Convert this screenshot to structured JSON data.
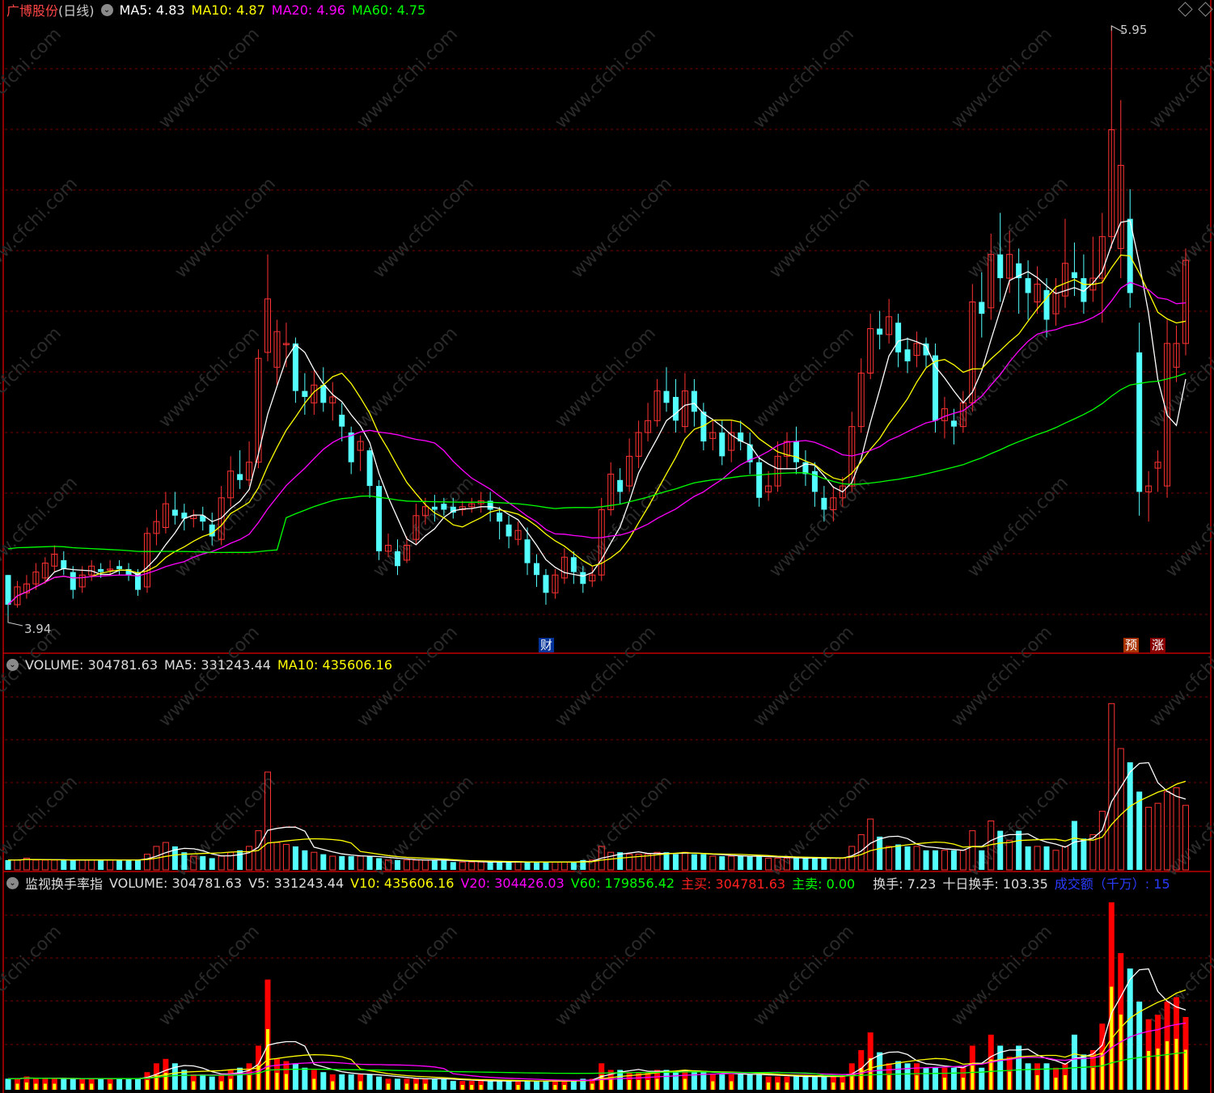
{
  "header": {
    "stock_name": "广博股份",
    "period": "(日线)",
    "ma5": "MA5: 4.83",
    "ma10": "MA10: 4.87",
    "ma20": "MA20: 4.96",
    "ma60": "MA60: 4.75"
  },
  "price_labels": {
    "high": "5.95",
    "low": "3.94"
  },
  "markers": {
    "cai": "财",
    "yu": "预",
    "zhang": "涨"
  },
  "volume_header": {
    "volume": "VOLUME: 304781.63",
    "ma5": "MA5: 331243.44",
    "ma10": "MA10: 435606.16"
  },
  "turnover_header": {
    "title": "监视换手率指",
    "volume": "VOLUME: 304781.63",
    "v5": "V5: 331243.44",
    "v10": "V10: 435606.16",
    "v20": "V20: 304426.03",
    "v60": "V60: 179856.42",
    "buy": "主买: 304781.63",
    "sell": "主卖: 0.00",
    "turnover": "换手: 7.23",
    "ten_day": "十日换手: 103.35",
    "amount": "成交额（千万）: 15"
  },
  "colors": {
    "up": "#ff3232",
    "down": "#54ffff",
    "ma5": "#ffffff",
    "ma10": "#ffff00",
    "ma20": "#ff00ff",
    "ma60": "#00ff00",
    "grid": "#7a0000",
    "separator": "#c00000"
  },
  "chart_data": {
    "type": "candlestick",
    "title": "广博股份 (日线)",
    "price_high": 5.95,
    "price_low": 3.94,
    "candles": [
      [
        4.1,
        4.0,
        4.1,
        3.94
      ],
      [
        4.0,
        4.06,
        4.08,
        3.99
      ],
      [
        4.04,
        4.07,
        4.1,
        4.02
      ],
      [
        4.07,
        4.11,
        4.14,
        4.05
      ],
      [
        4.09,
        4.14,
        4.16,
        4.07
      ],
      [
        4.13,
        4.17,
        4.2,
        4.11
      ],
      [
        4.15,
        4.12,
        4.18,
        4.1
      ],
      [
        4.11,
        4.05,
        4.13,
        4.02
      ],
      [
        4.06,
        4.1,
        4.13,
        4.04
      ],
      [
        4.1,
        4.13,
        4.15,
        4.08
      ],
      [
        4.12,
        4.11,
        4.14,
        4.09
      ],
      [
        4.12,
        4.12,
        4.15,
        4.1
      ],
      [
        4.13,
        4.12,
        4.15,
        4.1
      ],
      [
        4.12,
        4.1,
        4.14,
        4.08
      ],
      [
        4.11,
        4.05,
        4.12,
        4.03
      ],
      [
        4.06,
        4.24,
        4.26,
        4.04
      ],
      [
        4.24,
        4.28,
        4.32,
        4.2
      ],
      [
        4.26,
        4.34,
        4.38,
        4.24
      ],
      [
        4.32,
        4.3,
        4.38,
        4.27
      ],
      [
        4.31,
        4.29,
        4.34,
        4.25
      ],
      [
        4.29,
        4.3,
        4.32,
        4.26
      ],
      [
        4.3,
        4.28,
        4.33,
        4.25
      ],
      [
        4.27,
        4.23,
        4.31,
        4.2
      ],
      [
        4.22,
        4.36,
        4.4,
        4.2
      ],
      [
        4.36,
        4.45,
        4.5,
        4.33
      ],
      [
        4.44,
        4.42,
        4.52,
        4.39
      ],
      [
        4.42,
        4.48,
        4.55,
        4.4
      ],
      [
        4.48,
        4.83,
        4.86,
        4.46
      ],
      [
        4.85,
        5.03,
        5.18,
        4.82
      ],
      [
        4.8,
        4.92,
        4.96,
        4.74
      ],
      [
        4.88,
        4.88,
        4.95,
        4.8
      ],
      [
        4.88,
        4.72,
        4.9,
        4.68
      ],
      [
        4.72,
        4.7,
        4.78,
        4.64
      ],
      [
        4.68,
        4.74,
        4.79,
        4.64
      ],
      [
        4.74,
        4.68,
        4.8,
        4.65
      ],
      [
        4.68,
        4.7,
        4.75,
        4.62
      ],
      [
        4.64,
        4.6,
        4.68,
        4.55
      ],
      [
        4.58,
        4.48,
        4.6,
        4.44
      ],
      [
        4.52,
        4.55,
        4.57,
        4.45
      ],
      [
        4.52,
        4.4,
        4.53,
        4.36
      ],
      [
        4.4,
        4.18,
        4.42,
        4.15
      ],
      [
        4.18,
        4.2,
        4.24,
        4.16
      ],
      [
        4.18,
        4.13,
        4.22,
        4.1
      ],
      [
        4.15,
        4.2,
        4.23,
        4.14
      ],
      [
        4.22,
        4.3,
        4.34,
        4.2
      ],
      [
        4.3,
        4.33,
        4.36,
        4.27
      ],
      [
        4.33,
        4.32,
        4.37,
        4.28
      ],
      [
        4.34,
        4.32,
        4.36,
        4.3
      ],
      [
        4.33,
        4.31,
        4.36,
        4.29
      ],
      [
        4.32,
        4.33,
        4.35,
        4.3
      ],
      [
        4.33,
        4.34,
        4.36,
        4.31
      ],
      [
        4.34,
        4.35,
        4.38,
        4.31
      ],
      [
        4.35,
        4.32,
        4.38,
        4.28
      ],
      [
        4.31,
        4.28,
        4.33,
        4.22
      ],
      [
        4.27,
        4.23,
        4.3,
        4.19
      ],
      [
        4.22,
        4.25,
        4.28,
        4.2
      ],
      [
        4.22,
        4.14,
        4.26,
        4.1
      ],
      [
        4.14,
        4.1,
        4.17,
        4.06
      ],
      [
        4.1,
        4.04,
        4.12,
        4.0
      ],
      [
        4.04,
        4.1,
        4.12,
        4.02
      ],
      [
        4.09,
        4.16,
        4.19,
        4.07
      ],
      [
        4.16,
        4.11,
        4.18,
        4.07
      ],
      [
        4.11,
        4.07,
        4.13,
        4.04
      ],
      [
        4.08,
        4.1,
        4.13,
        4.06
      ],
      [
        4.1,
        4.32,
        4.36,
        4.08
      ],
      [
        4.32,
        4.44,
        4.48,
        4.3
      ],
      [
        4.42,
        4.38,
        4.46,
        4.34
      ],
      [
        4.4,
        4.5,
        4.56,
        4.38
      ],
      [
        4.5,
        4.58,
        4.62,
        4.46
      ],
      [
        4.58,
        4.62,
        4.68,
        4.55
      ],
      [
        4.62,
        4.72,
        4.76,
        4.6
      ],
      [
        4.72,
        4.68,
        4.8,
        4.65
      ],
      [
        4.7,
        4.62,
        4.76,
        4.58
      ],
      [
        4.6,
        4.72,
        4.78,
        4.58
      ],
      [
        4.72,
        4.65,
        4.76,
        4.6
      ],
      [
        4.65,
        4.55,
        4.68,
        4.52
      ],
      [
        4.56,
        4.58,
        4.62,
        4.52
      ],
      [
        4.58,
        4.5,
        4.62,
        4.47
      ],
      [
        4.52,
        4.58,
        4.62,
        4.48
      ],
      [
        4.58,
        4.55,
        4.62,
        4.52
      ],
      [
        4.54,
        4.48,
        4.58,
        4.44
      ],
      [
        4.48,
        4.36,
        4.5,
        4.33
      ],
      [
        4.38,
        4.4,
        4.45,
        4.35
      ],
      [
        4.4,
        4.5,
        4.55,
        4.38
      ],
      [
        4.5,
        4.55,
        4.58,
        4.46
      ],
      [
        4.55,
        4.48,
        4.6,
        4.44
      ],
      [
        4.48,
        4.44,
        4.52,
        4.4
      ],
      [
        4.45,
        4.38,
        4.48,
        4.33
      ],
      [
        4.36,
        4.32,
        4.4,
        4.28
      ],
      [
        4.32,
        4.36,
        4.4,
        4.28
      ],
      [
        4.36,
        4.4,
        4.43,
        4.33
      ],
      [
        4.4,
        4.6,
        4.65,
        4.38
      ],
      [
        4.6,
        4.78,
        4.83,
        4.58
      ],
      [
        4.78,
        4.93,
        4.98,
        4.76
      ],
      [
        4.93,
        4.91,
        4.99,
        4.86
      ],
      [
        4.91,
        4.97,
        5.03,
        4.88
      ],
      [
        4.95,
        4.85,
        4.98,
        4.8
      ],
      [
        4.86,
        4.82,
        4.9,
        4.78
      ],
      [
        4.84,
        4.88,
        4.92,
        4.8
      ],
      [
        4.88,
        4.84,
        4.9,
        4.8
      ],
      [
        4.84,
        4.62,
        4.88,
        4.58
      ],
      [
        4.62,
        4.66,
        4.7,
        4.56
      ],
      [
        4.62,
        4.6,
        4.66,
        4.54
      ],
      [
        4.6,
        4.68,
        4.72,
        4.58
      ],
      [
        4.68,
        5.02,
        5.08,
        4.65
      ],
      [
        5.02,
        4.98,
        5.12,
        4.9
      ],
      [
        5.0,
        5.18,
        5.25,
        4.96
      ],
      [
        5.18,
        5.1,
        5.32,
        5.02
      ],
      [
        5.1,
        5.18,
        5.26,
        5.05
      ],
      [
        5.15,
        5.1,
        5.2,
        4.98
      ],
      [
        5.1,
        5.05,
        5.16,
        4.96
      ],
      [
        5.02,
        5.08,
        5.14,
        4.98
      ],
      [
        5.06,
        4.96,
        5.1,
        4.9
      ],
      [
        4.98,
        5.05,
        5.1,
        4.94
      ],
      [
        5.04,
        5.15,
        5.3,
        5.0
      ],
      [
        5.12,
        5.1,
        5.22,
        5.04
      ],
      [
        5.1,
        5.02,
        5.18,
        4.98
      ],
      [
        5.06,
        5.1,
        5.24,
        5.02
      ],
      [
        5.1,
        5.24,
        5.32,
        4.95
      ],
      [
        5.24,
        5.6,
        5.95,
        5.2
      ],
      [
        5.2,
        5.48,
        5.7,
        5.1
      ],
      [
        5.3,
        5.05,
        5.4,
        5.0
      ],
      [
        4.85,
        4.38,
        4.95,
        4.3
      ],
      [
        4.38,
        4.4,
        4.45,
        4.28
      ],
      [
        4.46,
        4.48,
        4.52,
        4.38
      ],
      [
        4.4,
        4.88,
        4.96,
        4.36
      ],
      [
        4.8,
        4.88,
        4.94,
        4.75
      ],
      [
        4.88,
        5.16,
        5.2,
        4.84
      ]
    ],
    "volume": [
      0.05,
      0.05,
      0.06,
      0.05,
      0.05,
      0.05,
      0.05,
      0.05,
      0.05,
      0.05,
      0.05,
      0.05,
      0.05,
      0.05,
      0.05,
      0.08,
      0.12,
      0.14,
      0.12,
      0.09,
      0.07,
      0.07,
      0.06,
      0.07,
      0.09,
      0.1,
      0.12,
      0.2,
      0.5,
      0.14,
      0.13,
      0.12,
      0.1,
      0.09,
      0.08,
      0.07,
      0.07,
      0.07,
      0.07,
      0.07,
      0.06,
      0.05,
      0.05,
      0.05,
      0.05,
      0.05,
      0.05,
      0.05,
      0.04,
      0.04,
      0.04,
      0.04,
      0.04,
      0.04,
      0.04,
      0.04,
      0.04,
      0.04,
      0.04,
      0.04,
      0.04,
      0.04,
      0.05,
      0.05,
      0.12,
      0.09,
      0.09,
      0.08,
      0.08,
      0.08,
      0.09,
      0.09,
      0.08,
      0.09,
      0.08,
      0.08,
      0.07,
      0.07,
      0.07,
      0.07,
      0.07,
      0.07,
      0.06,
      0.06,
      0.06,
      0.06,
      0.06,
      0.06,
      0.06,
      0.06,
      0.06,
      0.12,
      0.18,
      0.26,
      0.17,
      0.12,
      0.13,
      0.12,
      0.12,
      0.1,
      0.1,
      0.1,
      0.1,
      0.1,
      0.2,
      0.1,
      0.25,
      0.2,
      0.15,
      0.2,
      0.12,
      0.12,
      0.12,
      0.1,
      0.12,
      0.25,
      0.16,
      0.18,
      0.3,
      0.85,
      0.62,
      0.55,
      0.4,
      0.32,
      0.34,
      0.4,
      0.42,
      0.33
    ]
  }
}
